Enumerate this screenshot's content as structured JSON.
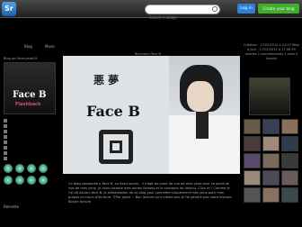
{
  "topbar": {
    "logo_text": "Sr",
    "search_placeholder": "Search in blogs",
    "login_label": "Log in",
    "create_label": "Create your blog"
  },
  "tabs": [
    "Blog",
    "Music"
  ],
  "header": {
    "title": "Bienvenu Face B"
  },
  "sidebar": {
    "caption": "Blog de Facebyedo29",
    "photo_label": "Face B",
    "photo_sub": "Flashback",
    "rows": [
      "",
      "",
      "",
      "",
      "",
      "",
      "",
      ""
    ],
    "link": "Rémotte"
  },
  "banner": {
    "kanji": "悪 夢",
    "name": "Face B"
  },
  "body": {
    "text": "Ce blog consacrée a Face B, au Kazu iaumu.. il s'agit du point de vue de mes yeux pour ce point de vue de mes yeux, je vous raconte mes autres fictions et le concepts de Akumu. Clics ici ! Comme je l'ai dit Akumu face B, le présentation de ce blog pour connaître simplement mes yeux pour mes propos en cours d'écriture. ©Par Jayko ~ Bon lecture qu'il même que je l'ai généré pas notre histoire. Bonne lecture"
  },
  "right": {
    "info": "Création : 17/02/2012 à 14:13 Mise à jour : 17/02/2012 à 17:08 59 articles 2 commentaires 2 amis 0 favoris"
  },
  "colors": {
    "login": "#2f7fd6",
    "create": "#3fae2a",
    "accent_pink": "#d84b7a"
  }
}
